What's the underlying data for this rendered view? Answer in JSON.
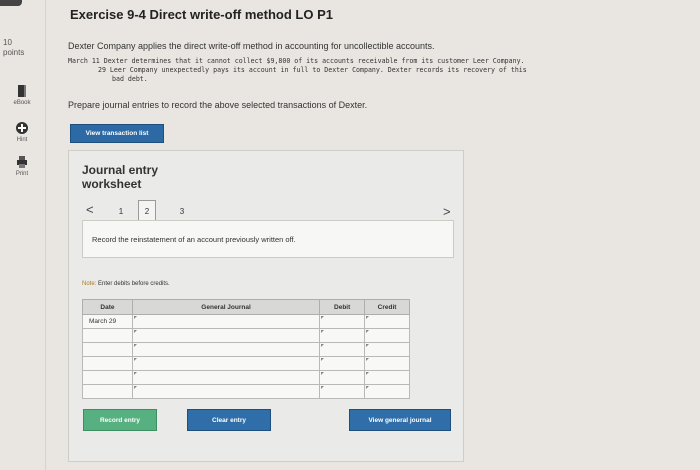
{
  "exercise": {
    "title": "Exercise 9-4 Direct write-off method LO P1",
    "intro": "Dexter Company applies the direct write-off method in accounting for uncollectible accounts.",
    "transactions": [
      "March 11 Dexter determines that it cannot collect $9,800 of its accounts receivable from its customer Leer Company.",
      "29 Leer Company unexpectedly pays its account in full to Dexter Company. Dexter records its recovery of this",
      "bad debt."
    ],
    "prepare_text": "Prepare journal entries to record the above selected transactions of Dexter.",
    "view_transactions_label": "View transaction list"
  },
  "sidebar": {
    "points_value": "10",
    "points_label": "points",
    "tools": [
      {
        "label": "eBook",
        "icon": "book-icon"
      },
      {
        "label": "Hint",
        "icon": "hint-icon"
      },
      {
        "label": "Print",
        "icon": "print-icon"
      }
    ]
  },
  "worksheet": {
    "title": "Journal entry worksheet",
    "pager": {
      "prev": "<",
      "next": ">",
      "pages": [
        "1",
        "2",
        "3"
      ],
      "active": "2"
    },
    "instruction": "Record the reinstatement of an account previously written off.",
    "note_label": "Note:",
    "note_text": "Enter debits before credits.",
    "columns": [
      "Date",
      "General Journal",
      "Debit",
      "Credit"
    ],
    "rows": [
      {
        "date": "March 29",
        "account": "",
        "debit": "",
        "credit": ""
      },
      {
        "date": "",
        "account": "",
        "debit": "",
        "credit": ""
      },
      {
        "date": "",
        "account": "",
        "debit": "",
        "credit": ""
      },
      {
        "date": "",
        "account": "",
        "debit": "",
        "credit": ""
      },
      {
        "date": "",
        "account": "",
        "debit": "",
        "credit": ""
      },
      {
        "date": "",
        "account": "",
        "debit": "",
        "credit": ""
      }
    ],
    "buttons": {
      "record": "Record entry",
      "clear": "Clear entry",
      "view_general_journal": "View general journal"
    }
  },
  "colors": {
    "primary_blue": "#2f6ea8",
    "record_green": "#56b07f",
    "note_label": "#b07a20"
  }
}
